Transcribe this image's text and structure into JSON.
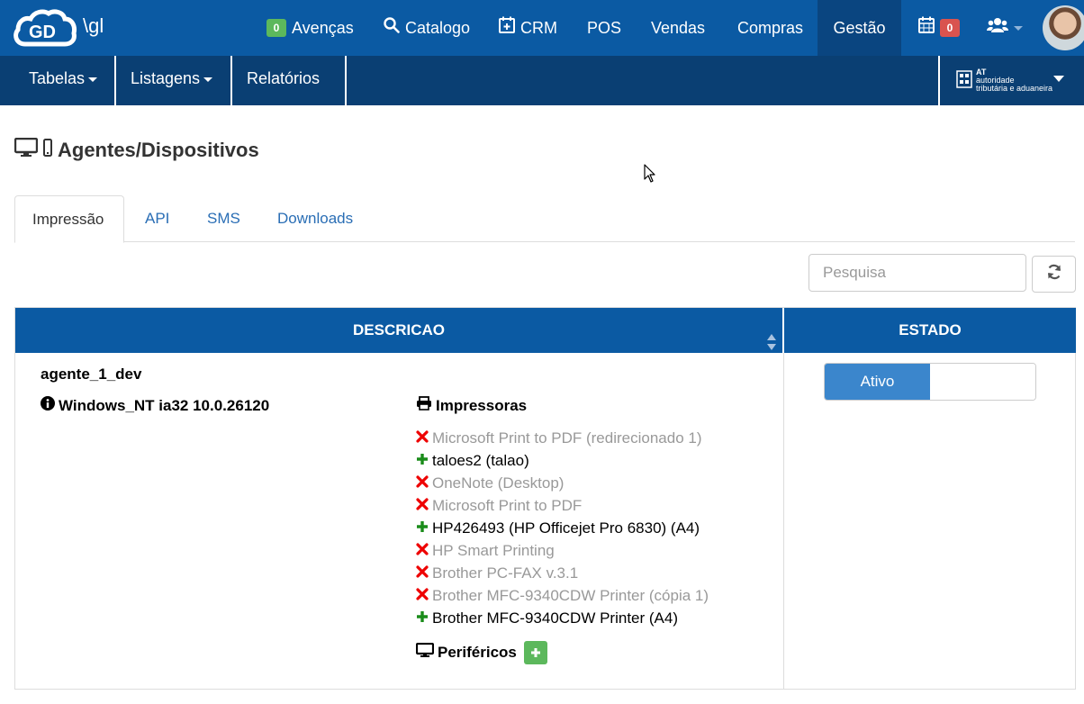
{
  "brand": {
    "text": "\\gl"
  },
  "topnav": {
    "avencas": {
      "badge": "0",
      "label": "Avenças"
    },
    "catalogo": {
      "label": "Catalogo"
    },
    "crm": {
      "label": "CRM"
    },
    "pos": {
      "label": "POS"
    },
    "vendas": {
      "label": "Vendas"
    },
    "compras": {
      "label": "Compras"
    },
    "gestao": {
      "label": "Gestão"
    },
    "calendar": {
      "badge": "0"
    }
  },
  "subnav": {
    "tabelas": "Tabelas",
    "listagens": "Listagens",
    "relatorios": "Relatórios",
    "at_logo": {
      "line1": "AT",
      "line2": "autoridade",
      "line3": "tributária e aduaneira"
    }
  },
  "page": {
    "title": "Agentes/Dispositivos"
  },
  "tabs": [
    {
      "label": "Impressão",
      "active": true
    },
    {
      "label": "API"
    },
    {
      "label": "SMS"
    },
    {
      "label": "Downloads"
    }
  ],
  "search": {
    "placeholder": "Pesquisa"
  },
  "table": {
    "headers": {
      "descricao": "DESCRICAO",
      "estado": "ESTADO"
    },
    "row": {
      "agent_name": "agente_1_dev",
      "os_info": "Windows_NT ia32 10.0.26120",
      "printers_heading": "Impressoras",
      "printers": [
        {
          "name": "Microsoft Print to PDF (redirecionado 1)",
          "enabled": false
        },
        {
          "name": "taloes2 (talao)",
          "enabled": true
        },
        {
          "name": "OneNote (Desktop)",
          "enabled": false
        },
        {
          "name": "Microsoft Print to PDF",
          "enabled": false
        },
        {
          "name": "HP426493 (HP Officejet Pro 6830) (A4)",
          "enabled": true
        },
        {
          "name": "HP Smart Printing",
          "enabled": false
        },
        {
          "name": "Brother PC-FAX v.3.1",
          "enabled": false
        },
        {
          "name": "Brother MFC-9340CDW Printer (cópia 1)",
          "enabled": false
        },
        {
          "name": "Brother MFC-9340CDW Printer (A4)",
          "enabled": true
        }
      ],
      "peripherals_heading": "Periféricos",
      "status": "Ativo"
    }
  },
  "colors": {
    "primary": "#0b5aa3",
    "subnav": "#0a3f73",
    "active_nav": "#0a4580",
    "success": "#5cb85c",
    "danger": "#d9534f",
    "toggle_on": "#3b86cc"
  }
}
